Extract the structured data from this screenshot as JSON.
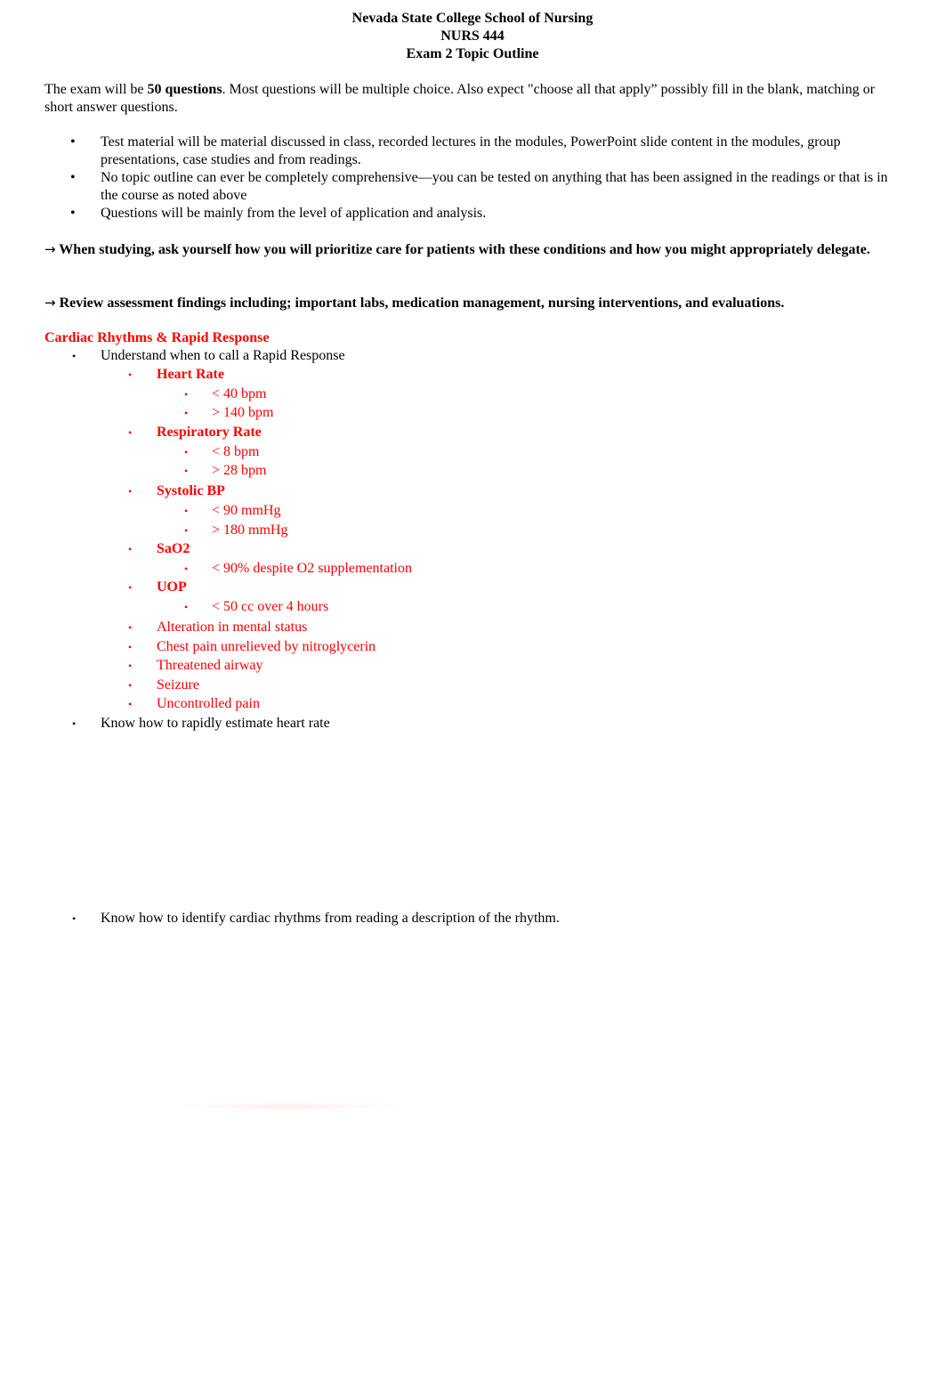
{
  "header": {
    "line1": "Nevada State College School of Nursing",
    "line2": "NURS 444",
    "line3": "Exam 2 Topic Outline"
  },
  "intro": {
    "before": "The exam will be ",
    "bold": "50 questions",
    "after": ".  Most questions will be multiple choice.  Also expect \"choose all that apply” possibly fill in the blank, matching or short answer questions."
  },
  "bullets": [
    "Test material will be material discussed in class, recorded lectures in the modules, PowerPoint slide content in the modules, group presentations, case studies and from readings.",
    "No topic outline can ever be completely comprehensive—you can be tested on anything that has been assigned in the readings or that is in the course as noted above",
    "Questions will be mainly from the level of application and analysis."
  ],
  "notes": [
    {
      "icon": "arrow-right-icon",
      "glyph": "→",
      "text": "When studying, ask yourself how you will prioritize care for patients with these conditions and how you might appropriately delegate."
    },
    {
      "icon": "arrow-right-icon",
      "glyph": "→",
      "text": "Review assessment findings including; important labs, medication management, nursing interventions, and evaluations."
    }
  ],
  "section": {
    "title": "Cardiac Rhythms & Rapid Response",
    "color": "#ff0000",
    "items": [
      {
        "level": 1,
        "text": "Understand when to call a Rapid Response",
        "bold": false,
        "red": false
      },
      {
        "level": 2,
        "text": "Heart Rate",
        "bold": true,
        "red": true
      },
      {
        "level": 3,
        "text": "< 40 bpm",
        "bold": false,
        "red": true
      },
      {
        "level": 3,
        "text": "> 140 bpm",
        "bold": false,
        "red": true
      },
      {
        "level": 2,
        "text": "Respiratory Rate",
        "bold": true,
        "red": true
      },
      {
        "level": 3,
        "text": "< 8 bpm",
        "bold": false,
        "red": true
      },
      {
        "level": 3,
        "text": "> 28 bpm",
        "bold": false,
        "red": true
      },
      {
        "level": 2,
        "text": "Systolic BP",
        "bold": true,
        "red": true
      },
      {
        "level": 3,
        "text": "< 90 mmHg",
        "bold": false,
        "red": true
      },
      {
        "level": 3,
        "text": "> 180 mmHg",
        "bold": false,
        "red": true
      },
      {
        "level": 2,
        "text": "SaO2",
        "bold": true,
        "red": true
      },
      {
        "level": 3,
        "text": "< 90% despite O2 supplementation",
        "bold": false,
        "red": true
      },
      {
        "level": 2,
        "text": "UOP",
        "bold": true,
        "red": true
      },
      {
        "level": 3,
        "text": "< 50 cc over 4 hours",
        "bold": false,
        "red": true
      },
      {
        "level": 2,
        "text": "Alteration in mental status",
        "bold": false,
        "red": true
      },
      {
        "level": 2,
        "text": "Chest pain unrelieved by nitroglycerin",
        "bold": false,
        "red": true
      },
      {
        "level": 2,
        "text": "Threatened airway",
        "bold": false,
        "red": true
      },
      {
        "level": 2,
        "text": "Seizure",
        "bold": false,
        "red": true
      },
      {
        "level": 2,
        "text": "Uncontrolled pain",
        "bold": false,
        "red": true
      },
      {
        "level": 1,
        "text": "Know how to rapidly estimate heart rate",
        "bold": false,
        "red": false
      },
      {
        "level": 1,
        "text": "Know how to identify cardiac rhythms from reading a description of the rhythm.",
        "bold": false,
        "red": false
      }
    ]
  },
  "bullet_glyph": "•"
}
